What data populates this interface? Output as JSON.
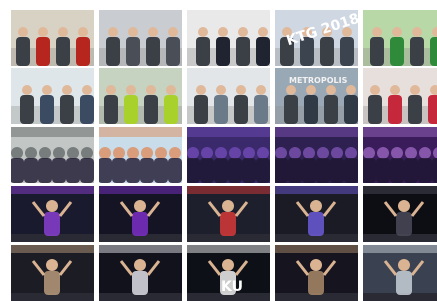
{
  "gallery": {
    "columns": 5,
    "rows": 5,
    "tiles": [
      {
        "icon": "photo-woman-speaking",
        "colors": [
          "#d8d2c4",
          "#b7251f"
        ]
      },
      {
        "icon": "photo-audience-seated",
        "colors": [
          "#c9cdd1",
          "#4a4f57"
        ]
      },
      {
        "icon": "photo-couple-posing",
        "colors": [
          "#e9e9ea",
          "#1f2430"
        ]
      },
      {
        "icon": "photo-ktg-2018-sign",
        "colors": [
          "#cfd8e2",
          "#3c4450"
        ],
        "caption": "KTG 2018"
      },
      {
        "icon": "photo-green-bags",
        "colors": [
          "#b8d8a8",
          "#2f8a3a"
        ]
      },
      {
        "icon": "photo-outdoor-crowd",
        "colors": [
          "#dfe6ea",
          "#3b4b62"
        ]
      },
      {
        "icon": "photo-stand-visitors",
        "colors": [
          "#c5d3c0",
          "#a9d12b"
        ]
      },
      {
        "icon": "photo-people-walking",
        "colors": [
          "#e3e6e9",
          "#6b7a88"
        ]
      },
      {
        "icon": "photo-metropolis-sign",
        "colors": [
          "#9aa8b5",
          "#2f3a46"
        ],
        "caption": "METROPOLIS"
      },
      {
        "icon": "photo-balloons-stand",
        "colors": [
          "#e7dfdc",
          "#c6283b"
        ]
      },
      {
        "icon": "photo-group-selfie",
        "colors": [
          "#c2c6c4",
          "#3a3f43"
        ]
      },
      {
        "icon": "photo-bouncy-castle",
        "colors": [
          "#c9dcea",
          "#e56a1f"
        ]
      },
      {
        "icon": "photo-purple-audience",
        "colors": [
          "#3a2a6c",
          "#8a5ad8"
        ]
      },
      {
        "icon": "photo-purple-audience-2",
        "colors": [
          "#2e2050",
          "#a06be0"
        ]
      },
      {
        "icon": "photo-purple-closeup",
        "colors": [
          "#3a1c5a",
          "#c486ef"
        ]
      },
      {
        "icon": "photo-stage-speaker",
        "colors": [
          "#1a1a2e",
          "#8a3fd0"
        ]
      },
      {
        "icon": "photo-stage-woman",
        "colors": [
          "#141424",
          "#7b2fc8"
        ]
      },
      {
        "icon": "photo-stage-mascot",
        "colors": [
          "#1d1f2d",
          "#d73a3a"
        ]
      },
      {
        "icon": "photo-stage-portrait",
        "colors": [
          "#1a1b24",
          "#6c5ad8"
        ]
      },
      {
        "icon": "photo-stage-dark",
        "colors": [
          "#0d0d14",
          "#4a4a58"
        ]
      },
      {
        "icon": "photo-stage-elder",
        "colors": [
          "#1b1c24",
          "#b79a7a"
        ]
      },
      {
        "icon": "photo-stage-dancers",
        "colors": [
          "#12121c",
          "#dfe0e8"
        ]
      },
      {
        "icon": "photo-stage-cheer",
        "colors": [
          "#0e1018",
          "#f0f0f0"
        ],
        "caption": "KU"
      },
      {
        "icon": "photo-stage-performer",
        "colors": [
          "#16141e",
          "#a98a6a"
        ]
      },
      {
        "icon": "photo-stage-hall",
        "colors": [
          "#3a4252",
          "#c8cfd8"
        ]
      }
    ]
  }
}
